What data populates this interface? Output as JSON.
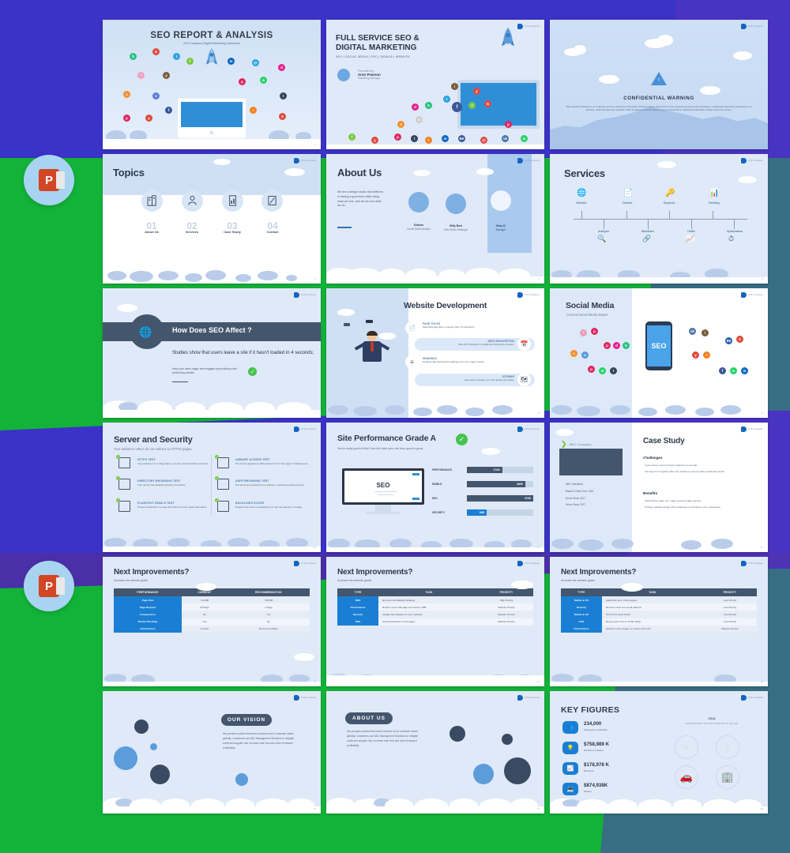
{
  "background": {
    "purple": "#3b32c8",
    "green": "#13b33a",
    "dark_purple": "#4b2fa8"
  },
  "badges": [
    {
      "name": "powerpoint-badge",
      "letter": "P"
    },
    {
      "name": "powerpoint-badge",
      "letter": "P"
    }
  ],
  "brand": {
    "logo_text": "XYZ Company"
  },
  "slides": [
    {
      "id": "seo-report-title",
      "title": "SEO REPORT & ANALYSIS",
      "subtitle": "XYZ Company Digital Marketing Solutions",
      "page": "1"
    },
    {
      "id": "full-service-seo",
      "title_line1": "FULL SERVICE SEO &",
      "title_line2": "DIGITAL MARKETING",
      "tags": "SEO | SOCIAL MEDIA | PPC | MOBILE | WEBSITE",
      "presented_label": "Presented by :",
      "presenter_name": "Aron Pearson",
      "presenter_role": "Marketing Manager",
      "page": "2"
    },
    {
      "id": "confidential-warning",
      "title": "CONFIDENTIAL WARNING",
      "body": "This material contained in our response and any material or information disclosed during discussions of the proposal represents the proprietary, confidential information pertaining to our services, methodologies and methods. Other products and brand names may be trademarks or registered trademarks of their respective owners.",
      "page": "3"
    },
    {
      "id": "topics",
      "title": "Topics",
      "items": [
        {
          "number": "01",
          "label": "About Us",
          "icon": "building-icon"
        },
        {
          "number": "02",
          "label": "Services",
          "icon": "person-icon"
        },
        {
          "number": "03",
          "label": "Case Study",
          "icon": "document-chart-icon"
        },
        {
          "number": "04",
          "label": "Contact",
          "icon": "pen-page-icon"
        }
      ],
      "page": "4"
    },
    {
      "id": "about-us",
      "title": "About Us",
      "body": "We are a design studio that believes in having a good time while doing what we love, and we do love what we do.",
      "people": [
        {
          "name": "Gibson",
          "role": "Social Media Analyst"
        },
        {
          "name": "Billy Bob",
          "role": "Paid Media Strategist"
        },
        {
          "name": "Jimy G.",
          "role": "Manager"
        }
      ],
      "page": "5"
    },
    {
      "id": "services",
      "title": "Services",
      "top_items": [
        {
          "label": "Website",
          "icon": "globe-icon"
        },
        {
          "label": "Content",
          "icon": "document-icon"
        },
        {
          "label": "Keyword",
          "icon": "key-icon"
        },
        {
          "label": "Ranking",
          "icon": "bar-chart-icon"
        }
      ],
      "bottom_items": [
        {
          "label": "Analysis",
          "icon": "magnifier-chart-icon"
        },
        {
          "label": "Backlinks",
          "icon": "link-icon"
        },
        {
          "label": "Traffic",
          "icon": "trend-line-icon"
        },
        {
          "label": "Optimization",
          "icon": "gauge-icon"
        }
      ],
      "page": "6"
    },
    {
      "id": "how-does-seo-affect",
      "title": "How Does SEO Affect ?",
      "headline": "Studies show that users leave a site if it hasn't loaded in 4 seconds;",
      "note": "Keep your users happy and engaged by providing a fast performing website.",
      "page": "7"
    },
    {
      "id": "website-development",
      "title": "Website Development",
      "items": [
        {
          "heading": "PAGE TITLES",
          "body": "Splendid page titles no longer than 70 characters.",
          "icon": "page-title-icon",
          "align": "left"
        },
        {
          "heading": "META DESCRIPTION",
          "body": "Max 155 characters in length and should be relevant.",
          "icon": "calendar-icon",
          "align": "right"
        },
        {
          "heading": "HEADINGS",
          "body": "Heading tags distinguish headings from core page content.",
          "icon": "lines-icon",
          "align": "left"
        },
        {
          "heading": "SITEMAP",
          "body": "Help users navigate your site quickly and easily.",
          "icon": "map-icon",
          "align": "right"
        }
      ],
      "page": "8"
    },
    {
      "id": "social-media",
      "title": "Social Media",
      "subtitle": "Current Social Media status!",
      "phone_label": "SEO",
      "page": "9"
    },
    {
      "id": "server-and-security",
      "title": "Server and Security",
      "subtitle": "Your website's URLs do not redirect to HTTPS pages.",
      "items": [
        {
          "heading": "HTTPS TEST",
          "body": "Your website is not using https, a secure communication protocol.",
          "icon": "https-file-icon"
        },
        {
          "heading": "DIRECTORY BROWSING TEST",
          "body": "Your server has disabled directory browsing.",
          "icon": "folder-icon"
        },
        {
          "heading": "PLAINTEXT EMAILS TEST",
          "body": "Protect email links in a way that hides from the spam harvesters.",
          "icon": "envelope-icon"
        },
        {
          "heading": "LIBRARY ACCESS TEST",
          "body": "Our server appears to allow access from User-agent: Libwww-perl+",
          "icon": "printer-icon"
        },
        {
          "heading": "SAFE BROWSING TEST",
          "body": "Not listed as suspicious (no malware or phishing activity found).",
          "icon": "magnifier-check-icon"
        },
        {
          "heading": "BACKLINKS SCORE",
          "body": "People who work in marketing try to get the attention of target.",
          "icon": "link-pen-icon"
        }
      ],
      "page": "10"
    },
    {
      "id": "site-performance-grade-a",
      "title": "Site Performance Grade A",
      "subtitle": "You're really good at this! Now let's take your site from good to great.",
      "screen_label": "SEO",
      "metrics": [
        {
          "label": "PERFORMANCE",
          "value": "17/30",
          "percent": 53,
          "accent": false
        },
        {
          "label": "MOBILE",
          "value": "28/30",
          "percent": 88,
          "accent": false
        },
        {
          "label": "SEO",
          "value": "47/30",
          "percent": 100,
          "accent": false
        },
        {
          "label": "SECURITY",
          "value": "8/30",
          "percent": 30,
          "accent": true
        }
      ],
      "page": "11"
    },
    {
      "id": "case-study",
      "title": "Case Study",
      "company": "ABC Company",
      "company_facts": [
        "ABC Distributor",
        "Based In New York, USA",
        "Serve Since 2017",
        "Serve Since 2017"
      ],
      "challenges_heading": "Challenges",
      "challenges": [
        "Users leave a site if it hasn't loaded in 4 seconds",
        "The layout is irregular when the website is opened with a particular device."
      ],
      "benefits_heading": "Benefits",
      "benefits": [
        "Optimization page size, page speed & page request.",
        "Change website design with media query techniques to be responsive."
      ],
      "page": "12"
    },
    {
      "id": "next-improvements-1",
      "title": "Next Improvements?",
      "subtitle": "Increase the website grade",
      "columns": [
        "PERFORMANCE",
        "CURRENT",
        "RECOMMENDATION"
      ],
      "rows": [
        [
          "Page Size",
          "3.9 MB",
          "<50 MB"
        ],
        [
          "Page Request",
          "49 Page",
          "3 Page"
        ],
        [
          "Compression",
          "No",
          "Yes"
        ],
        [
          "Render Blocking",
          "Yes",
          "No"
        ],
        [
          "Performance",
          "Current",
          "Recommendation"
        ]
      ],
      "page": "13"
    },
    {
      "id": "next-improvements-2",
      "title": "Next Improvements?",
      "subtitle": "Increase the website grade",
      "columns": [
        "TYPE",
        "TASK",
        "PRIORITY"
      ],
      "rows": [
        [
          "SEO",
          "Excutre Link Building Strategy",
          "High Priority"
        ],
        [
          "Performance",
          "Reduce your total page size below 3 MB.",
          "Medium Priority"
        ],
        [
          "Security",
          "Update the software on your website.",
          "Medium Priority"
        ],
        [
          "SEO",
          "Add alt attributes to all images",
          "Medium Priority"
        ]
      ],
      "page": "14"
    },
    {
      "id": "next-improvements-3",
      "title": "Next Improvements?",
      "subtitle": "Increase the website grade",
      "columns": [
        "TYPE",
        "TASK",
        "PRIORITY"
      ],
      "rows": [
        [
          "Mobile & UX",
          "Adjust the size of tap targets.",
          "Low Priority"
        ],
        [
          "Security",
          "Remove clear text email address",
          "Low Priority"
        ],
        [
          "Mobile & UX",
          "Set a Print Style Sheet",
          "Low Priority"
        ],
        [
          "CEO",
          "Review your Text to HTML Ratio",
          "Low Priority"
        ],
        [
          "Performance",
          "Optimize your images to reduce their size",
          "Medium Priority"
        ]
      ],
      "page": "15"
    },
    {
      "id": "our-vision",
      "badge": "OUR VISION",
      "body": "We provides solution that meet a diverse set of customer needs globally. Customers can ABC Management Solutions to mitigate credit and supplier risk, increase cash flow and drive increased profitability.",
      "page": "16"
    },
    {
      "id": "about-us-bottom",
      "badge": "ABOUT US",
      "body": "We provides solution that meet a diverse set of customer needs globally. Customers can ABC Management Solutions to mitigate credit and supplier risk, increase cash flow and drive increased profitability.",
      "page": "17"
    },
    {
      "id": "key-figures",
      "title": "KEY FIGURES",
      "figures": [
        {
          "value": "234,000",
          "label": "Employee worldwide",
          "icon": "people-icon"
        },
        {
          "value": "$758,989 K",
          "label": "Business Volume",
          "icon": "bulb-icon"
        },
        {
          "value": "$178,978 K",
          "label": "Revenue",
          "icon": "chart-icon"
        },
        {
          "value": "$874,938K",
          "label": "Shares",
          "icon": "screen-icon"
        }
      ],
      "year": "2014",
      "year_subtitle": "SOME RECIPIENTS THAT ARE PLACED END OF THE YEAR",
      "page": "18"
    }
  ]
}
